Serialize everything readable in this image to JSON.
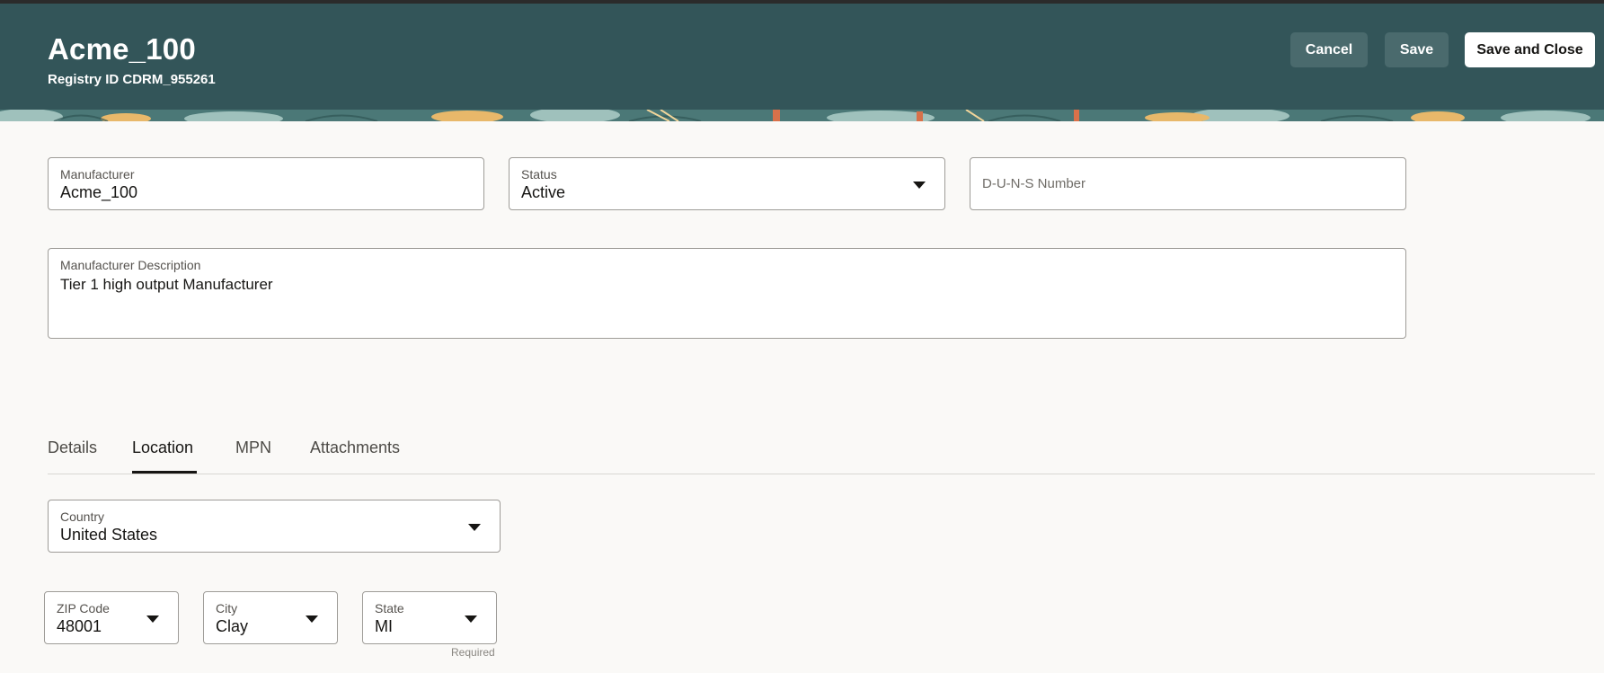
{
  "header": {
    "title": "Acme_100",
    "subtitle": "Registry ID CDRM_955261",
    "buttons": {
      "cancel": "Cancel",
      "save": "Save",
      "save_close": "Save and Close"
    },
    "colors": {
      "background": "#335559",
      "ghost_button": "#4a6a6d"
    }
  },
  "form": {
    "manufacturer": {
      "label": "Manufacturer",
      "value": "Acme_100"
    },
    "status": {
      "label": "Status",
      "value": "Active"
    },
    "duns": {
      "placeholder": "D-U-N-S Number"
    },
    "description": {
      "label": "Manufacturer Description",
      "value": "Tier 1 high output Manufacturer"
    }
  },
  "tabs": [
    {
      "label": "Details",
      "active": false
    },
    {
      "label": "Location",
      "active": true
    },
    {
      "label": "MPN",
      "active": false
    },
    {
      "label": "Attachments",
      "active": false
    }
  ],
  "location": {
    "country": {
      "label": "Country",
      "value": "United States"
    },
    "zip": {
      "label": "ZIP Code",
      "value": "48001"
    },
    "city": {
      "label": "City",
      "value": "Clay"
    },
    "state": {
      "label": "State",
      "value": "MI",
      "helper": "Required"
    }
  },
  "icons": {
    "dropdown": "chevron-down-icon"
  }
}
